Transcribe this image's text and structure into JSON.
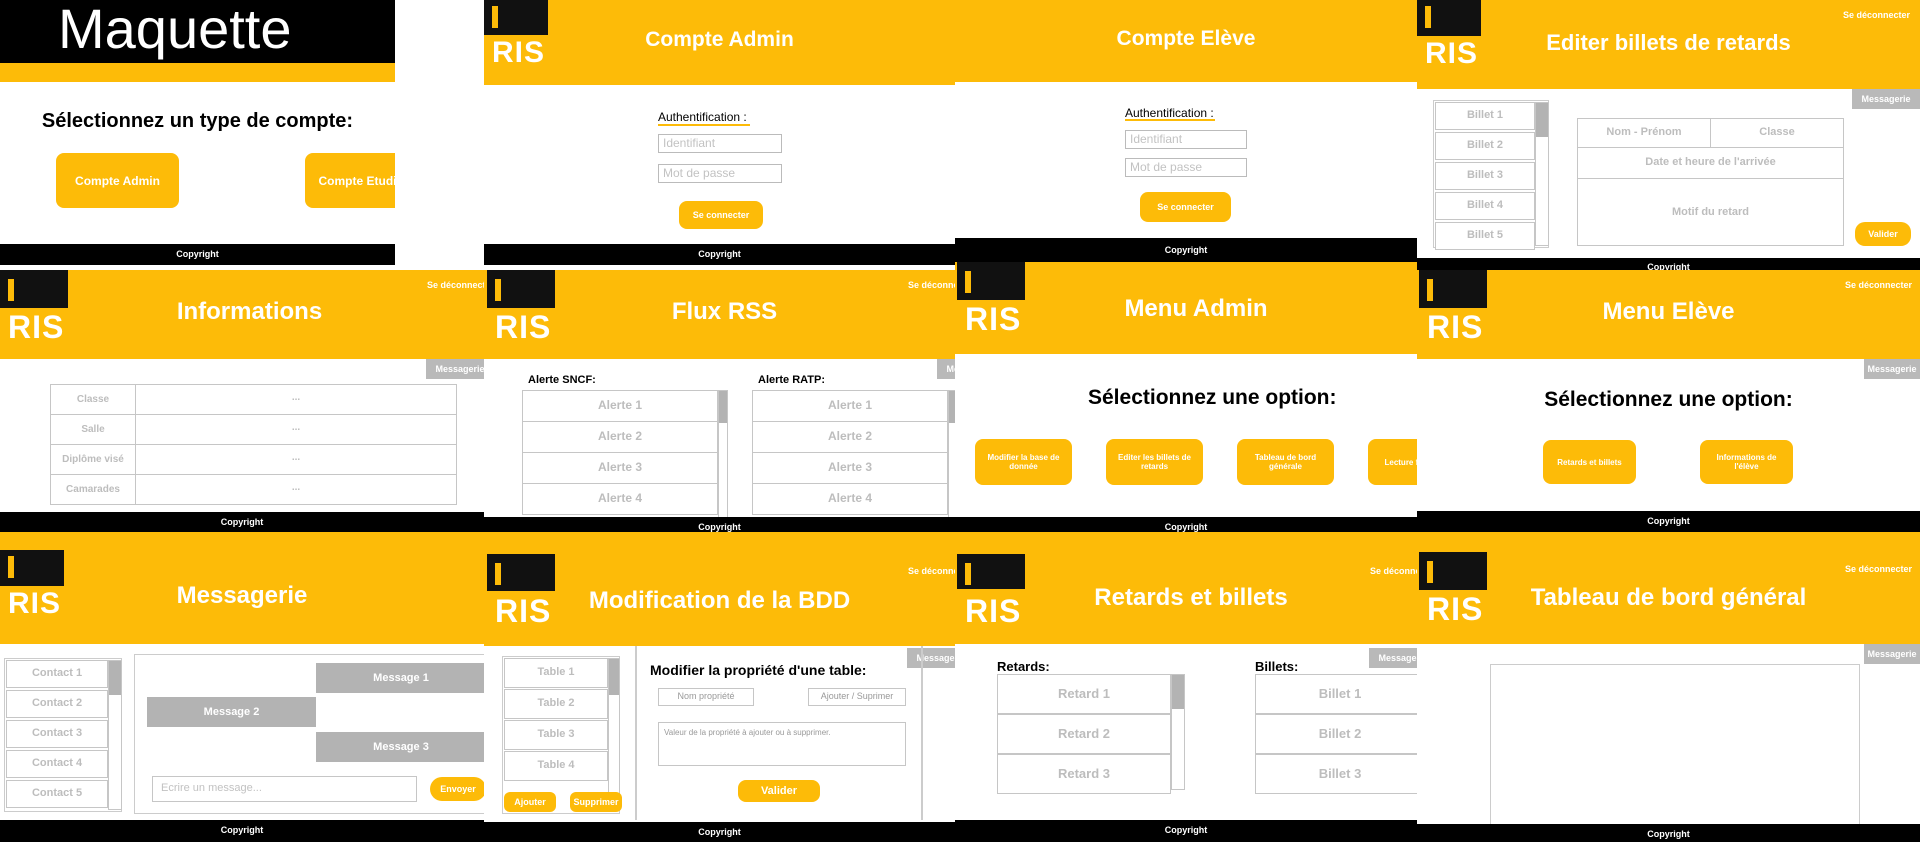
{
  "common": {
    "copyright": "Copyright",
    "logo_text": "RIS",
    "logout": "Se déconnecter",
    "messaging": "Messagerie"
  },
  "maquette": {
    "title": "Maquette",
    "heading": "Sélectionnez un type de compte:",
    "btn_admin": "Compte Admin",
    "btn_student": "Compte Etudiant"
  },
  "admin_login": {
    "title": "Compte Admin",
    "auth_label": "Authentification :",
    "id_placeholder": "Identifiant",
    "pw_placeholder": "Mot de passe",
    "connect": "Se connecter"
  },
  "student_login": {
    "title": "Compte Elève",
    "auth_label": "Authentification :",
    "id_placeholder": "Identifiant",
    "pw_placeholder": "Mot de passe",
    "connect": "Se connecter"
  },
  "edit_tickets": {
    "title": "Editer billets de retards",
    "tickets": [
      "Billet 1",
      "Billet 2",
      "Billet 3",
      "Billet 4",
      "Billet 5"
    ],
    "name": "Nom - Prénom",
    "class": "Classe",
    "datetime": "Date et heure de l'arrivée",
    "reason": "Motif du retard",
    "validate": "Valider"
  },
  "informations": {
    "title": "Informations",
    "rows": [
      {
        "label": "Classe",
        "value": "..."
      },
      {
        "label": "Salle",
        "value": "..."
      },
      {
        "label": "Diplôme visé",
        "value": "..."
      },
      {
        "label": "Camarades",
        "value": "..."
      }
    ]
  },
  "rss": {
    "title": "Flux RSS",
    "sncf_label": "Alerte SNCF:",
    "ratp_label": "Alerte RATP:",
    "sncf": [
      "Alerte 1",
      "Alerte 2",
      "Alerte 3",
      "Alerte 4"
    ],
    "ratp": [
      "Alerte 1",
      "Alerte 2",
      "Alerte 3",
      "Alerte 4"
    ]
  },
  "admin_menu": {
    "title": "Menu Admin",
    "heading": "Sélectionnez une option:",
    "options": [
      "Modifier la base de donnée",
      "Editer les billets de retards",
      "Tableau de bord générale",
      "Lecture flux RSS"
    ]
  },
  "student_menu": {
    "title": "Menu Elève",
    "heading": "Sélectionnez une option:",
    "options": [
      "Retards et billets",
      "Informations de l'élève"
    ]
  },
  "messagerie": {
    "title": "Messagerie",
    "contacts": [
      "Contact 1",
      "Contact 2",
      "Contact 3",
      "Contact 4",
      "Contact 5"
    ],
    "messages": [
      "Message 1",
      "Message 2",
      "Message 3"
    ],
    "placeholder": "Ecrire un message...",
    "send": "Envoyer"
  },
  "bdd": {
    "title": "Modification de la BDD",
    "tables": [
      "Table 1",
      "Table 2",
      "Table 3",
      "Table 4"
    ],
    "add": "Ajouter",
    "delete": "Supprimer",
    "heading": "Modifier la propriété d'une table:",
    "prop_name": "Nom propriété",
    "add_del": "Ajouter / Suprimer",
    "value_placeholder": "Valeur de la propriété à ajouter ou à supprimer.",
    "validate": "Valider"
  },
  "retards": {
    "title": "Retards et billets",
    "retards_label": "Retards:",
    "billets_label": "Billets:",
    "retards": [
      "Retard 1",
      "Retard 2",
      "Retard 3"
    ],
    "billets": [
      "Billet 1",
      "Billet 2",
      "Billet 3"
    ]
  },
  "dashboard": {
    "title": "Tableau de bord général"
  }
}
